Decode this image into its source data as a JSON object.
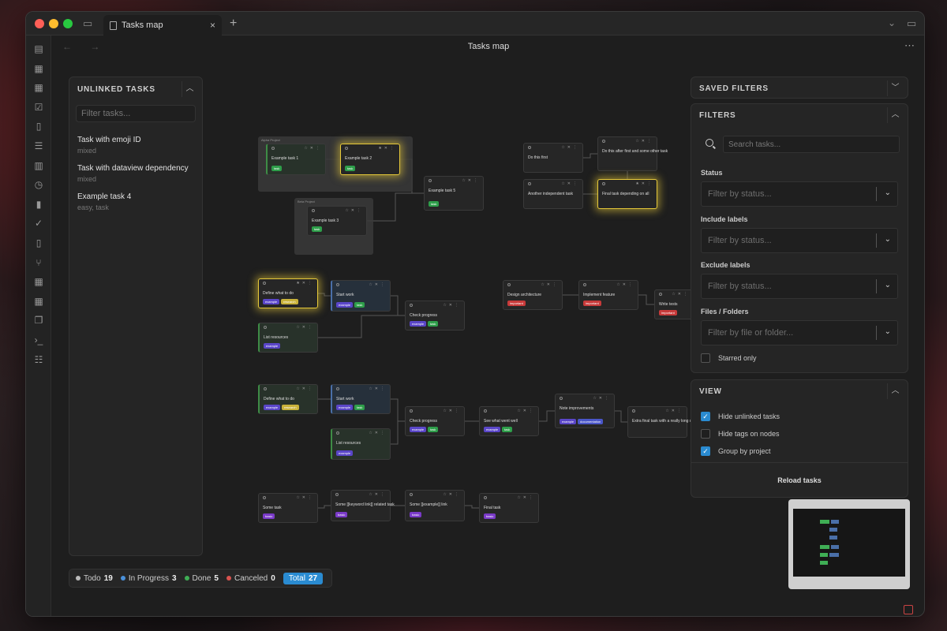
{
  "window": {
    "tab_title": "Tasks map",
    "tab_close": "×",
    "new_tab": "+",
    "page_title": "Tasks map",
    "nav_arrows": "←  →",
    "more": "⋯",
    "chevron": "⌄",
    "sidebar_toggle": "▭"
  },
  "ribbon_icons": [
    "map-icon",
    "calendar-icon",
    "calendar-day-icon",
    "checkbox-icon",
    "file-icon",
    "list-icon",
    "columns-icon",
    "timer-icon",
    "bar-chart-icon",
    "double-check-icon",
    "document-icon",
    "git-branch-icon",
    "grid-icon",
    "calendar-alt-icon",
    "copy-icon",
    "terminal-icon",
    "checklist-icon"
  ],
  "unlinked": {
    "title": "UNLINKED TASKS",
    "placeholder": "Filter tasks...",
    "items": [
      {
        "title": "Task with emoji ID",
        "sub": "mixed"
      },
      {
        "title": "Task with dataview dependency",
        "sub": "mixed"
      },
      {
        "title": "Example task 4",
        "sub": "easy, task"
      }
    ]
  },
  "status_bar": {
    "todo_label": "Todo",
    "todo_count": "19",
    "progress_label": "In Progress",
    "progress_count": "3",
    "done_label": "Done",
    "done_count": "5",
    "canceled_label": "Canceled",
    "canceled_count": "0",
    "total_label": "Total",
    "total_count": "27",
    "colors": {
      "todo": "#bbbbbb",
      "progress": "#4a90d9",
      "done": "#3fae55",
      "canceled": "#d9534f"
    }
  },
  "saved_filters": {
    "title": "SAVED FILTERS"
  },
  "filters": {
    "title": "FILTERS",
    "search_placeholder": "Search tasks...",
    "status_label": "Status",
    "status_placeholder": "Filter by status...",
    "include_label": "Include labels",
    "include_placeholder": "Filter by status...",
    "exclude_label": "Exclude labels",
    "exclude_placeholder": "Filter by status...",
    "files_label": "Files / Folders",
    "files_placeholder": "Filter by file or folder...",
    "starred_label": "Starred only"
  },
  "view": {
    "title": "VIEW",
    "hide_unlinked": "Hide unlinked tasks",
    "hide_tags": "Hide tags on nodes",
    "group_project": "Group by project",
    "reload": "Reload tasks"
  },
  "graph": {
    "groups": [
      {
        "label": "Alpha Project"
      },
      {
        "label": "Beta Project"
      }
    ],
    "nodes": [
      {
        "title": "Example task 1",
        "tag": "task"
      },
      {
        "title": "Example task 2",
        "tag": "task"
      },
      {
        "title": "Example task 3",
        "tag": "task"
      },
      {
        "title": "Example task 5",
        "tag": "task"
      },
      {
        "title": "Do this first",
        "tag": ""
      },
      {
        "title": "Do this after first and some other task",
        "tag": ""
      },
      {
        "title": "Another independent task",
        "tag": ""
      },
      {
        "title": "Final task depending on all",
        "tag": ""
      },
      {
        "title": "Define what to do",
        "tag": "example",
        "tag2": "research"
      },
      {
        "title": "Start work",
        "tag": "example",
        "tag2": "task"
      },
      {
        "title": "Check progress",
        "tag": "example",
        "tag2": "task"
      },
      {
        "title": "List resources",
        "tag": "example"
      },
      {
        "title": "Design architecture",
        "tag": "important"
      },
      {
        "title": "Implement feature",
        "tag": "important"
      },
      {
        "title": "Write tests",
        "tag": "important"
      },
      {
        "title": "Define what to do",
        "tag": "example",
        "tag2": "research"
      },
      {
        "title": "Start work",
        "tag": "example",
        "tag2": "task"
      },
      {
        "title": "Check progress",
        "tag": "example",
        "tag2": "task"
      },
      {
        "title": "See what went well",
        "tag": "example",
        "tag2": "task"
      },
      {
        "title": "Note improvements",
        "tag": "example",
        "tag2": "documentation"
      },
      {
        "title": "Extra final task with a really long description here",
        "tag": ""
      },
      {
        "title": "List resources",
        "tag": "example"
      },
      {
        "title": "Some task",
        "tag": "basic"
      },
      {
        "title": "Some [[keyword link]] related task",
        "tag": "basic"
      },
      {
        "title": "Some [[example]] link",
        "tag": "basic"
      },
      {
        "title": "Final task",
        "tag": "basic"
      }
    ]
  }
}
